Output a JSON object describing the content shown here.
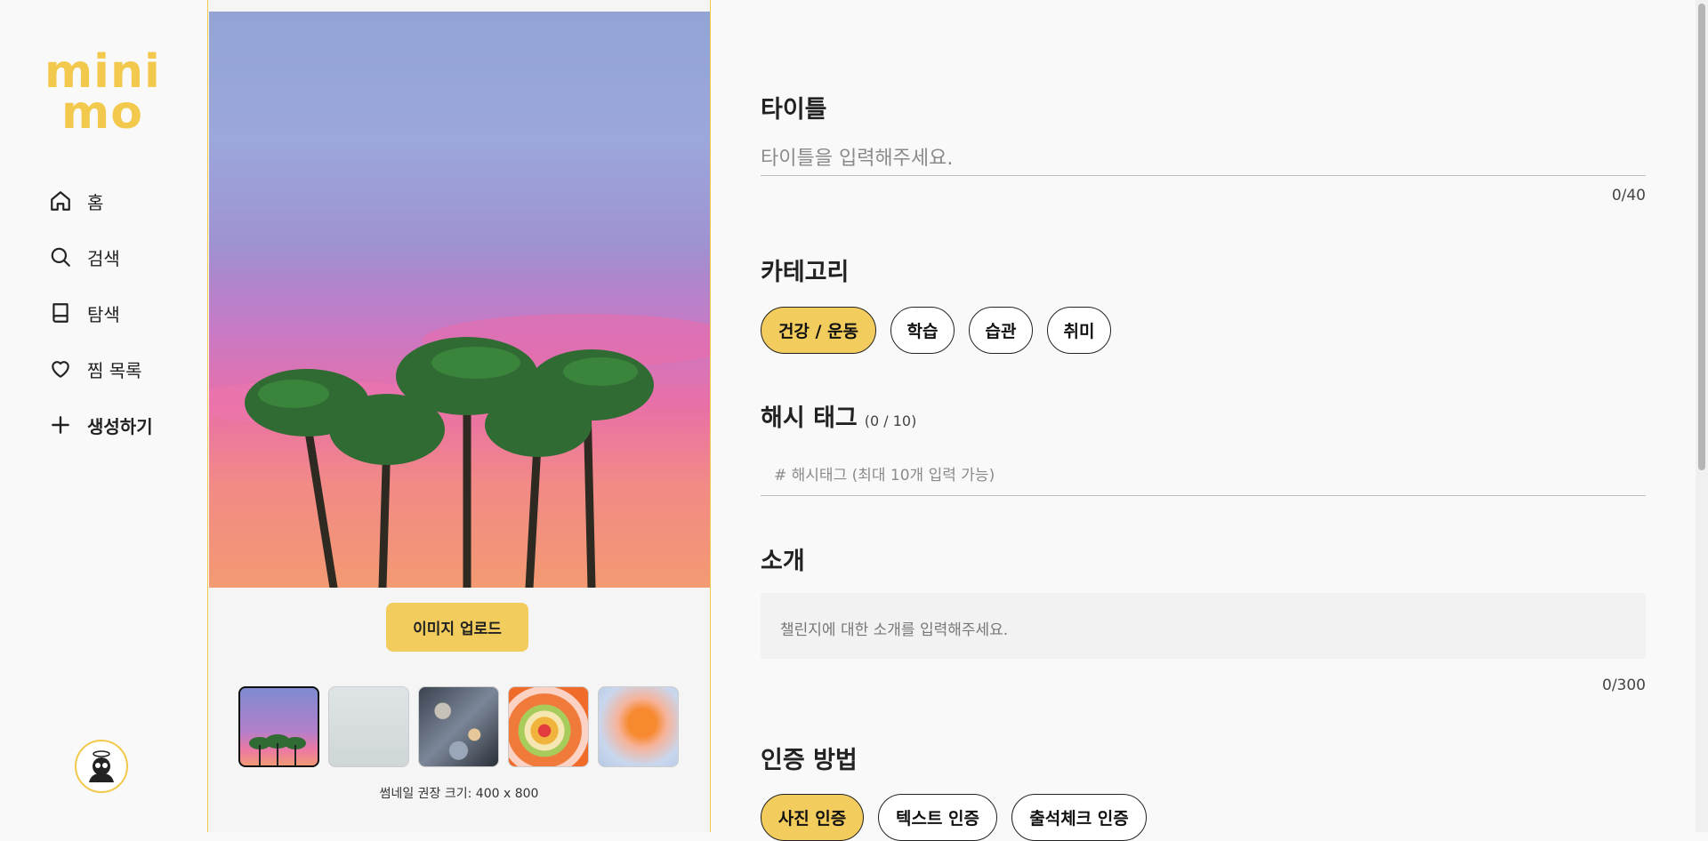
{
  "app": {
    "logo_line1": "mini",
    "logo_line2": "mo",
    "brand_color": "#f2c94c"
  },
  "sidebar": {
    "items": [
      {
        "label": "홈",
        "icon": "home-icon"
      },
      {
        "label": "검색",
        "icon": "search-icon"
      },
      {
        "label": "탐색",
        "icon": "book-icon"
      },
      {
        "label": "찜 목록",
        "icon": "heart-icon"
      },
      {
        "label": "생성하기",
        "icon": "plus-icon"
      }
    ],
    "avatar_icon": "profile-avatar"
  },
  "image_panel": {
    "upload_label": "이미지 업로드",
    "thumbnail_note": "썸네일 권장 크기: 400 x 800",
    "thumbnails": [
      "palm-sunset",
      "light-gray",
      "speckle-pattern",
      "concentric-rings",
      "orange-blur"
    ],
    "selected_thumbnail": 0
  },
  "form": {
    "title": {
      "label": "타이틀",
      "placeholder": "타이틀을 입력해주세요.",
      "counter": "0/40"
    },
    "category": {
      "label": "카테고리",
      "options": [
        "건강 / 운동",
        "학습",
        "습관",
        "취미"
      ],
      "selected": "건강 / 운동"
    },
    "hashtag": {
      "label": "해시 태그",
      "count": "(0 / 10)",
      "placeholder": "# 해시태그 (최대 10개 입력 가능)"
    },
    "intro": {
      "label": "소개",
      "placeholder": "챌린지에 대한 소개를 입력해주세요.",
      "counter": "0/300"
    },
    "auth": {
      "label": "인증 방법",
      "options": [
        "사진 인증",
        "텍스트 인증",
        "출석체크 인증"
      ],
      "selected": "사진 인증"
    }
  },
  "colors": {
    "accent": "#f2cc5c",
    "text": "#222222",
    "background": "#f9f9f9"
  }
}
